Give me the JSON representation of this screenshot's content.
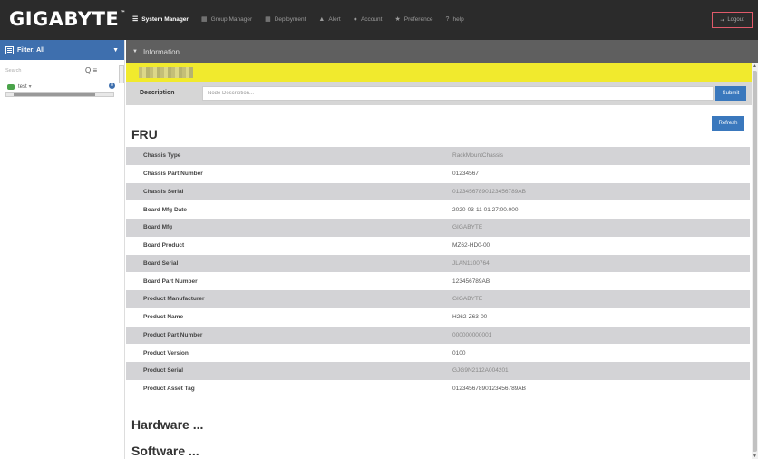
{
  "brand": {
    "name": "GIGABYTE",
    "tm": "™"
  },
  "nav": [
    {
      "label": "System Manager",
      "icon": "list-icon",
      "glyph": "☰",
      "active": true
    },
    {
      "label": "Group Manager",
      "icon": "grid-icon",
      "glyph": "▦",
      "active": false
    },
    {
      "label": "Deployment",
      "icon": "grid-icon",
      "glyph": "▦",
      "active": false
    },
    {
      "label": "Alert",
      "icon": "warning-icon",
      "glyph": "▲",
      "active": false
    },
    {
      "label": "Account",
      "icon": "user-icon",
      "glyph": "●",
      "active": false
    },
    {
      "label": "Preference",
      "icon": "star-icon",
      "glyph": "★",
      "active": false
    },
    {
      "label": "help",
      "icon": "question-icon",
      "glyph": "?",
      "active": false
    }
  ],
  "logout": {
    "label": "Logout",
    "icon": "sign-out-icon",
    "glyph": "⇥"
  },
  "sidebar": {
    "filter_label": "Filter: All",
    "search_placeholder": "Search",
    "search_icons": "Q ≡",
    "tree_item": "test",
    "tree_caret": "▾",
    "badge": "8",
    "caret": "▼"
  },
  "main": {
    "section_title": "Information",
    "section_toggle": "▼",
    "description_label": "Description",
    "description_placeholder": "Node Description...",
    "submit_label": "Submit",
    "refresh_label": "Refresh",
    "fru_title": "FRU",
    "hardware_title": "Hardware ...",
    "software_title": "Software ..."
  },
  "fru": [
    {
      "key": "Chassis Type",
      "value": "RackMountChassis"
    },
    {
      "key": "Chassis Part Number",
      "value": "01234567"
    },
    {
      "key": "Chassis Serial",
      "value": "0123456789012345678 9AB"
    },
    {
      "key": "Board Mfg Date",
      "value": "2020-03-11 01:27:00.000"
    },
    {
      "key": "Board Mfg",
      "value": "GIGABYTE"
    },
    {
      "key": "Board Product",
      "value": "MZ62-HD0-00"
    },
    {
      "key": "Board Serial",
      "value": "JLAN1100764"
    },
    {
      "key": "Board Part Number",
      "value": "123456789AB"
    },
    {
      "key": "Product Manufacturer",
      "value": "GIGABYTE"
    },
    {
      "key": "Product Name",
      "value": "H262-Z63-00"
    },
    {
      "key": "Product Part Number",
      "value": "000000000001"
    },
    {
      "key": "Product Version",
      "value": "0100"
    },
    {
      "key": "Product Serial",
      "value": "GJG9N2112A004201"
    },
    {
      "key": "Product Asset Tag",
      "value": "01234567890123456789AB"
    }
  ],
  "colors": {
    "topbar": "#2b2b2b",
    "accent": "#3e6fae",
    "button": "#3a78bd",
    "highlight": "#f1ea2d",
    "logout_border": "#e05a6a"
  }
}
